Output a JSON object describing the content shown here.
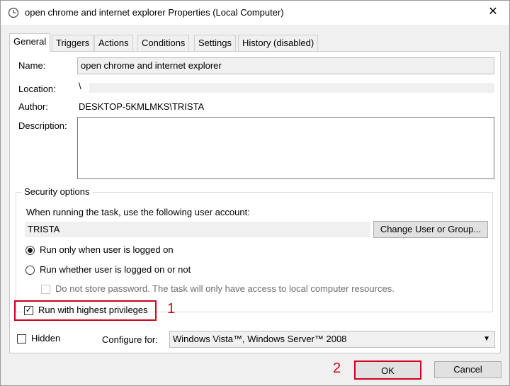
{
  "window": {
    "title": "open chrome and internet explorer Properties (Local Computer)",
    "close_glyph": "✕"
  },
  "tabs": [
    {
      "label": "General",
      "active": true
    },
    {
      "label": "Triggers"
    },
    {
      "label": "Actions"
    },
    {
      "label": "Conditions"
    },
    {
      "label": "Settings"
    },
    {
      "label": "History (disabled)"
    }
  ],
  "general": {
    "name_label": "Name:",
    "name_value": "open chrome and internet explorer",
    "location_label": "Location:",
    "location_value": "\\",
    "author_label": "Author:",
    "author_value": "DESKTOP-5KMLMKS\\TRISTA",
    "description_label": "Description:",
    "description_value": ""
  },
  "security": {
    "group_label": "Security options",
    "account_prompt": "When running the task, use the following user account:",
    "account_value": "TRISTA",
    "change_button": "Change User or Group...",
    "radio_logged_on": "Run only when user is logged on",
    "radio_logged_on_checked": true,
    "radio_whether": "Run whether user is logged on or not",
    "radio_whether_checked": false,
    "no_store_password": "Do not store password.  The task will only have access to local computer resources.",
    "highest_privileges": "Run with highest privileges",
    "highest_privileges_checked": true
  },
  "bottom": {
    "hidden_label": "Hidden",
    "hidden_checked": false,
    "configure_label": "Configure for:",
    "configure_value": "Windows Vista™, Windows Server™ 2008"
  },
  "buttons": {
    "ok": "OK",
    "cancel": "Cancel"
  },
  "annotations": {
    "step1": "1",
    "step2": "2",
    "color": "#d0021b"
  },
  "icons": {
    "app": "task-scheduler-icon",
    "close": "close-icon",
    "check": "✓",
    "chevron": "chevron-down-icon"
  }
}
